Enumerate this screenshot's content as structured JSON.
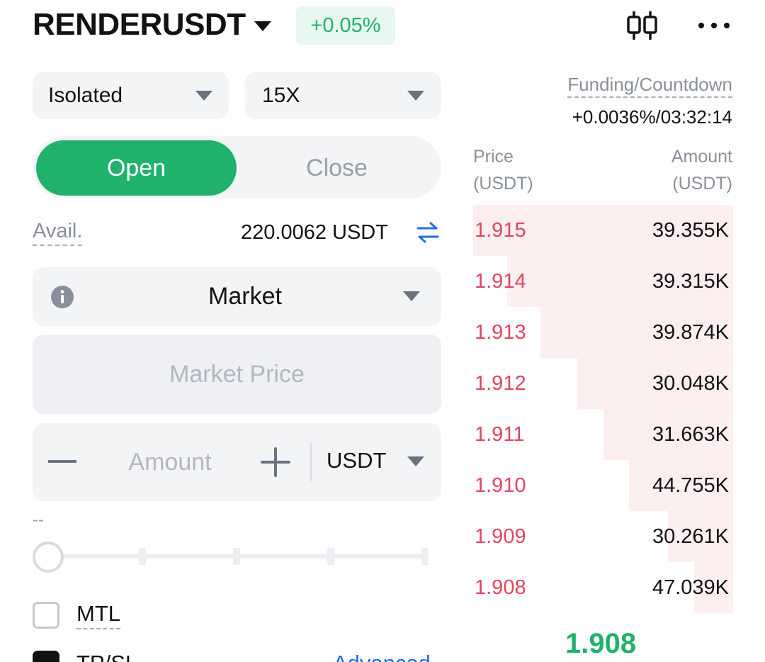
{
  "header": {
    "symbol": "RENDERUSDT",
    "change": "+0.05%",
    "colors": {
      "up": "#20b26c",
      "down": "#e0475e"
    }
  },
  "margin_mode": {
    "value": "Isolated"
  },
  "leverage": {
    "value": "15X"
  },
  "tabs": {
    "open_label": "Open",
    "close_label": "Close",
    "active": "Open"
  },
  "avail": {
    "label": "Avail.",
    "value": "220.0062 USDT"
  },
  "order_type": {
    "value": "Market"
  },
  "price_field": {
    "placeholder": "Market Price"
  },
  "amount_field": {
    "placeholder": "Amount",
    "unit": "USDT"
  },
  "slider": {
    "value_text": "--",
    "percent": 0
  },
  "options": {
    "mtl_label": "MTL",
    "mtl_checked": false,
    "tpsl_label": "TP/SL",
    "tpsl_checked": true,
    "advanced_label": "Advanced"
  },
  "funding": {
    "label": "Funding/Countdown",
    "value": "+0.0036%/03:32:14"
  },
  "orderbook": {
    "price_header_1": "Price",
    "price_header_2": "(USDT)",
    "amount_header_1": "Amount",
    "amount_header_2": "(USDT)",
    "asks": [
      {
        "price": "1.915",
        "amount": "39.355K",
        "depth": 1.0
      },
      {
        "price": "1.914",
        "amount": "39.315K",
        "depth": 0.87
      },
      {
        "price": "1.913",
        "amount": "39.874K",
        "depth": 0.74
      },
      {
        "price": "1.912",
        "amount": "30.048K",
        "depth": 0.6
      },
      {
        "price": "1.911",
        "amount": "31.663K",
        "depth": 0.5
      },
      {
        "price": "1.910",
        "amount": "44.755K",
        "depth": 0.4
      },
      {
        "price": "1.909",
        "amount": "30.261K",
        "depth": 0.25
      },
      {
        "price": "1.908",
        "amount": "47.039K",
        "depth": 0.15
      }
    ],
    "last_price": "1.908"
  }
}
